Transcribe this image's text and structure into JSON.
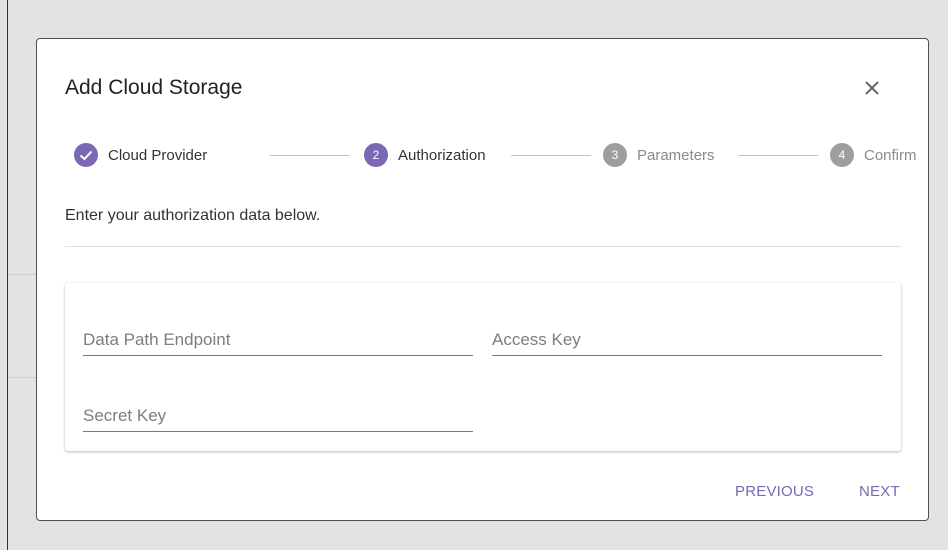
{
  "dialog": {
    "title": "Add Cloud Storage",
    "close_icon": "close-icon",
    "accent_color": "#7b68b4",
    "inactive_step_color": "#9e9e9e"
  },
  "stepper": {
    "steps": [
      {
        "number": "✓",
        "label": "Cloud Provider",
        "status": "completed"
      },
      {
        "number": "2",
        "label": "Authorization",
        "status": "active"
      },
      {
        "number": "3",
        "label": "Parameters",
        "status": "inactive"
      },
      {
        "number": "4",
        "label": "Confirm",
        "status": "inactive"
      }
    ]
  },
  "content": {
    "instructions": "Enter your authorization data below.",
    "fields": {
      "data_path_endpoint": {
        "value": "",
        "placeholder": "Data Path Endpoint"
      },
      "access_key": {
        "value": "",
        "placeholder": "Access Key"
      },
      "secret_key": {
        "value": "",
        "placeholder": "Secret Key"
      }
    }
  },
  "actions": {
    "previous_label": "PREVIOUS",
    "next_label": "NEXT"
  }
}
